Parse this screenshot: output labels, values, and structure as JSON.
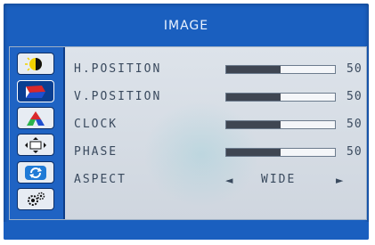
{
  "osd": {
    "title": "IMAGE",
    "rail": [
      {
        "name": "brightness-contrast",
        "icon": "brightness-contrast-icon",
        "active": false
      },
      {
        "name": "image",
        "icon": "image-adjust-icon",
        "active": true
      },
      {
        "name": "color",
        "icon": "color-icon",
        "active": false
      },
      {
        "name": "osd",
        "icon": "osd-position-icon",
        "active": false
      },
      {
        "name": "reset",
        "icon": "reset-icon",
        "active": false
      },
      {
        "name": "setup",
        "icon": "gear-icon",
        "active": false
      }
    ],
    "rows": [
      {
        "label": "H.POSITION",
        "value": "50",
        "level": 0.5
      },
      {
        "label": "V.POSITION",
        "value": "50",
        "level": 0.5
      },
      {
        "label": "CLOCK",
        "value": "50",
        "level": 0.5
      },
      {
        "label": "PHASE",
        "value": "50",
        "level": 0.5
      }
    ],
    "aspect": {
      "label": "ASPECT",
      "value": "WIDE",
      "left_arrow": "◄",
      "right_arrow": "►"
    }
  },
  "colors": {
    "frame": "#1a5fbf",
    "panel": "#dde3ea",
    "text": "#3a4a5e",
    "bar_fill": "#3f4652"
  }
}
